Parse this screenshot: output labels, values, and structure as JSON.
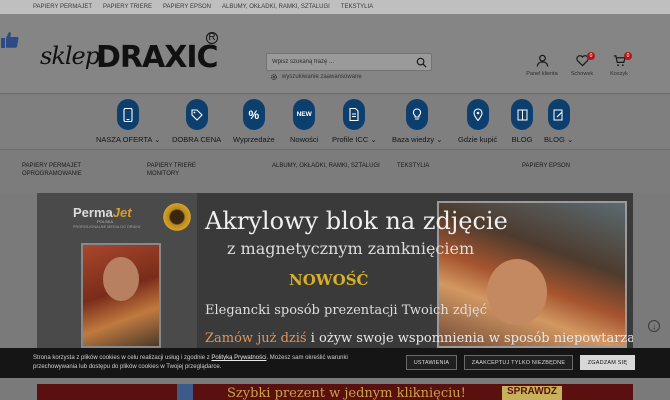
{
  "topbar": {
    "links": [
      "PAPIERY Permajet",
      "PAPIERY TRIERE",
      "PAPIERY EPSON",
      "ALBUMY, OKŁADKI, RAMKI, SZTALUGI",
      "TEKSTYLIA"
    ]
  },
  "logo": {
    "script": "sklep",
    "brand_left": "DRA",
    "brand_x": "X",
    "brand_right": "IC",
    "reg": "R"
  },
  "search": {
    "placeholder": "Wpisz szukaną frazę ...",
    "advanced": "wyszukiwanie zaawansowane"
  },
  "header_icons": {
    "account": "Panel klienta",
    "wishlist": "Schowek",
    "wishlist_count": "0",
    "cart": "Koszyk",
    "cart_count": "0"
  },
  "nav": {
    "items": [
      {
        "label": "NASZA OFERTA",
        "chevron": "⌄"
      },
      {
        "label": "DOBRA CENA"
      },
      {
        "label": "Wyprzedaże"
      },
      {
        "label": "Nowości",
        "icon_text": "NEW"
      },
      {
        "label": "Profile ICC",
        "chevron": "⌄"
      },
      {
        "label": "Baza wiedzy",
        "chevron": "⌄"
      },
      {
        "label": "Gdzie kupić"
      },
      {
        "label": "BLOG"
      },
      {
        "label": "BLOG",
        "chevron": "⌄"
      }
    ]
  },
  "subnav": {
    "col1": [
      "PAPIERY Permajet",
      "OPROGRAMOWANIE"
    ],
    "col2": [
      "PAPIERY TRIERE",
      "MONITORY"
    ],
    "col3": [
      "ALBUMY, OKŁADKI, RAMKI, SZTALUGI"
    ],
    "col4": [
      "TEKSTYLIA"
    ],
    "col5": [
      "PAPIERY EPSON"
    ]
  },
  "banner": {
    "brand": "Perma",
    "brand_accent": "Jet",
    "brand_sub": "POLSKA",
    "tagline": "PROFESJONALNE MEDIA DO DRUKU",
    "title": "Akrylowy blok na zdjęcie",
    "subtitle": "z magnetycznym zamknięciem",
    "new_label": "NOWOŚĆ",
    "line4": "Elegancki sposób prezentacji Twoich zdjęć",
    "line5_a": "Zamów już dziś",
    "line5_b": " i ożyw swoje wspomnienia w sposób niepowtarzalny!"
  },
  "cookie": {
    "text_before": "Strona korzysta z plików cookies w celu realizacji usług i zgodnie z ",
    "policy_link": "Polityką Prywatności",
    "text_after": ". Możesz sam określić warunki przechowywania lub dostępu do plików cookies w Twojej przeglądarce.",
    "btn_settings": "USTAWIENIA",
    "btn_necessary": "ZAAKCEPTUJ TYLKO NIEZBĘDNE",
    "btn_agree": "ZGADZAM SIĘ"
  },
  "bottom_banner": {
    "text": "Szybki prezent w jednym kliknięciu!",
    "cta": "SPRAWDŹ"
  }
}
